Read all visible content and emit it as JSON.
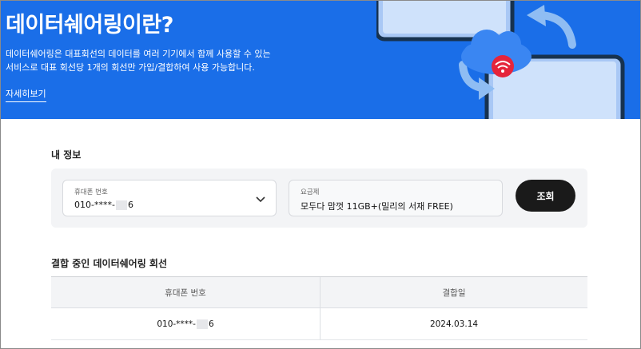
{
  "banner": {
    "title": "데이터쉐어링이란?",
    "desc_line1": "데이터쉐어링은 대표회선의 데이터를 여러 기기에서 함께 사용할 수 있는",
    "desc_line2": "서비스로 대표 회선당 1개의 회선만 가입/결합하여 사용 가능합니다.",
    "detail_link": "자세히보기"
  },
  "my_info": {
    "section_title": "내 정보",
    "phone_label": "휴대폰 번호",
    "phone_prefix": "010-****-",
    "phone_suffix": "6",
    "plan_label": "요금제",
    "plan_value": "모두다 맘껏 11GB+(밀리의 서재 FREE)",
    "lookup_button": "조회"
  },
  "combined_lines": {
    "section_title": "결합 중인 데이터쉐어링 회선",
    "columns": [
      "휴대폰 번호",
      "결합일"
    ],
    "rows": [
      {
        "phone_prefix": "010-****-",
        "phone_suffix": "6",
        "date": "2024.03.14"
      }
    ]
  },
  "colors": {
    "banner_bg": "#1a6ee8",
    "button_bg": "#1a1a1a",
    "wifi_badge": "#e5243b"
  }
}
